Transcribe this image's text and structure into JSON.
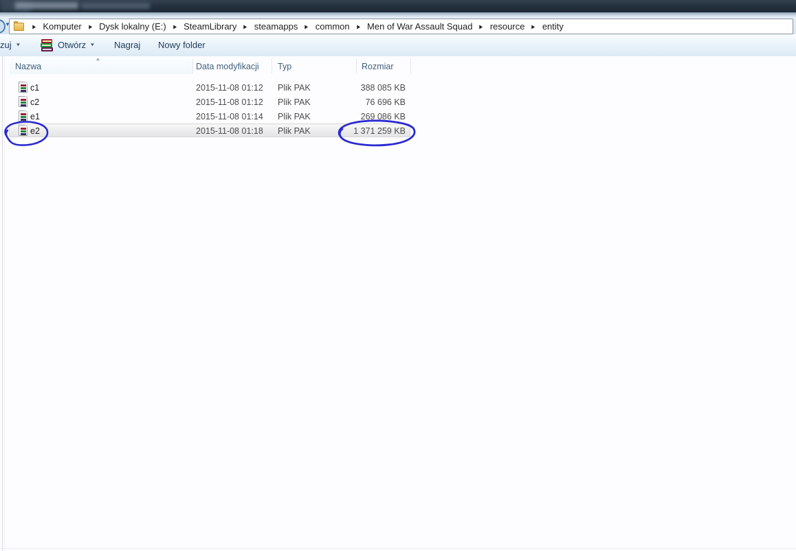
{
  "address_bar": {
    "breadcrumb": [
      "Komputer",
      "Dysk lokalny (E:)",
      "SteamLibrary",
      "steamapps",
      "common",
      "Men of War Assault Squad",
      "resource",
      "entity"
    ]
  },
  "toolbar": {
    "organize_partial_label": "zuj",
    "open_label": "Otwórz",
    "burn_label": "Nagraj",
    "new_folder_label": "Nowy folder"
  },
  "file_list": {
    "columns": [
      "Nazwa",
      "Data modyfikacji",
      "Typ",
      "Rozmiar"
    ],
    "rows": [
      {
        "name": "c1",
        "date_modified": "2015-11-08 01:12",
        "type": "Plik PAK",
        "size": "388 085 KB"
      },
      {
        "name": "c2",
        "date_modified": "2015-11-08 01:12",
        "type": "Plik PAK",
        "size": "76 696 KB"
      },
      {
        "name": "e1",
        "date_modified": "2015-11-08 01:14",
        "type": "Plik PAK",
        "size": "269 086 KB"
      },
      {
        "name": "e2",
        "date_modified": "2015-11-08 01:18",
        "type": "Plik PAK",
        "size": "1 371 259 KB"
      }
    ],
    "selected_row_name": "e2",
    "sort_column": "Nazwa",
    "sort_direction": "ascending"
  },
  "icons": {
    "breadcrumb_arrow": "▶",
    "dropdown_arrow": "▼",
    "sort_ascending": "▲",
    "nav_history_arrow": "▼"
  },
  "annotations": {
    "color": "#2a2ad0",
    "circled_items": [
      "e2",
      "1 371 259 KB"
    ]
  },
  "colors": {
    "titlebar_dark": "#222e3c",
    "toolbar_text": "#1e3b5c",
    "header_text": "#41607c",
    "selection_highlight": "#ededee"
  }
}
